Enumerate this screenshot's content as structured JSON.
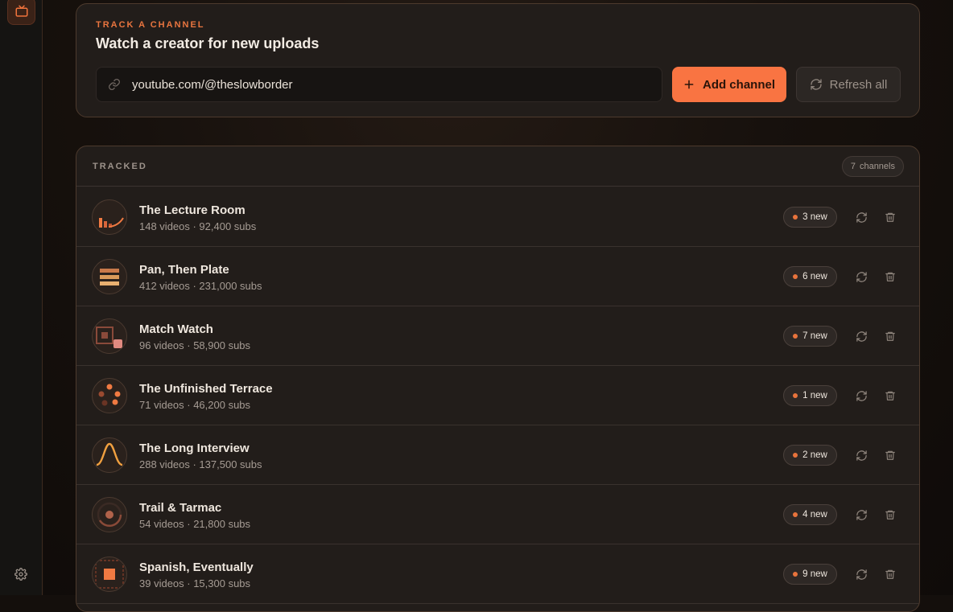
{
  "track": {
    "eyebrow": "TRACK A CHANNEL",
    "title": "Watch a creator for new uploads",
    "url_value": "youtube.com/@theslowborder",
    "add_label": "Add channel",
    "refresh_all_label": "Refresh all"
  },
  "tracked": {
    "label": "TRACKED",
    "count": "7",
    "count_unit": "channels",
    "channels": [
      {
        "name": "The Lecture Room",
        "meta": "148 videos · 92,400 subs",
        "new": "3 new",
        "avatar": "bars-curve"
      },
      {
        "name": "Pan, Then Plate",
        "meta": "412 videos · 231,000 subs",
        "new": "6 new",
        "avatar": "stacked-bars"
      },
      {
        "name": "Match Watch",
        "meta": "96 videos · 58,900 subs",
        "new": "7 new",
        "avatar": "squares"
      },
      {
        "name": "The Unfinished Terrace",
        "meta": "71 videos · 46,200 subs",
        "new": "1 new",
        "avatar": "dots"
      },
      {
        "name": "The Long Interview",
        "meta": "288 videos · 137,500 subs",
        "new": "2 new",
        "avatar": "bell-curve"
      },
      {
        "name": "Trail & Tarmac",
        "meta": "54 videos · 21,800 subs",
        "new": "4 new",
        "avatar": "ring"
      },
      {
        "name": "Spanish, Eventually",
        "meta": "39 videos · 15,300 subs",
        "new": "9 new",
        "avatar": "framed-square"
      }
    ]
  },
  "colors": {
    "accent": "#f97442",
    "background": "#140f0c",
    "card": "#221d1a"
  }
}
